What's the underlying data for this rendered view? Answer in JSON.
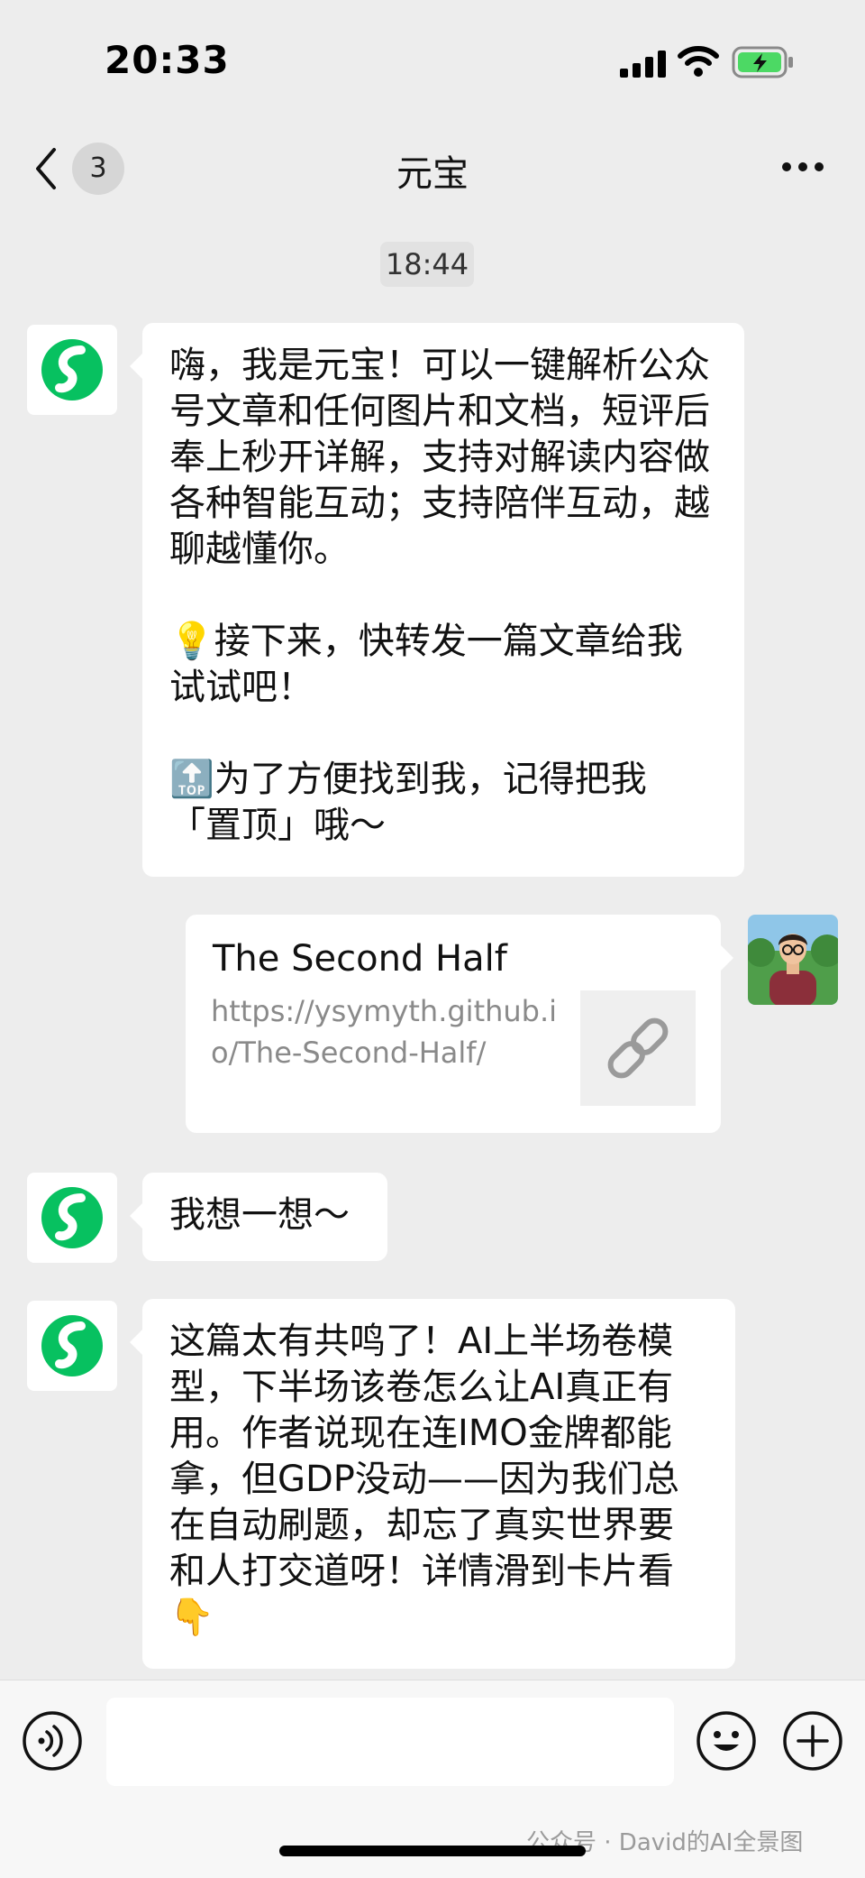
{
  "status_bar": {
    "time": "20:33",
    "icons": [
      "signal-icon",
      "wifi-icon",
      "battery-charging-icon"
    ],
    "battery_color": "#4cd964"
  },
  "nav": {
    "unread_count": "3",
    "title": "元宝",
    "icons": [
      "chevron-left-icon",
      "more-icon"
    ]
  },
  "chat": {
    "timestamp": "18:44",
    "messages": [
      {
        "sender": "bot",
        "paragraphs": [
          "嗨，我是元宝！可以一键解析公众号文章和任何图片和文档，短评后奉上秒开详解，支持对解读内容做各种智能互动；支持陪伴互动，越聊越懂你。",
          "💡接下来，快转发一篇文章给我试试吧！",
          "🔝为了方便找到我，记得把我「置顶」哦～"
        ]
      },
      {
        "sender": "user",
        "card": {
          "title": "The Second Half",
          "url": "https://ysymyth.github.io/The-Second-Half/",
          "thumb_icon": "link-icon"
        }
      },
      {
        "sender": "bot",
        "text": "我想一想～"
      },
      {
        "sender": "bot",
        "text": "这篇太有共鸣了！AI上半场卷模型，下半场该卷怎么让AI真正有用。作者说现在连IMO金牌都能拿，但GDP没动——因为我们总在自动刷题，却忘了真实世界要和人打交道呀！详情滑到卡片看👇"
      }
    ]
  },
  "input_bar": {
    "icons": [
      "voice-icon",
      "emoji-icon",
      "plus-icon"
    ],
    "value": ""
  },
  "watermark": "公众号 · David的AI全景图",
  "colors": {
    "background": "#ededed",
    "bubble": "#ffffff",
    "bot_green": "#07c160"
  }
}
